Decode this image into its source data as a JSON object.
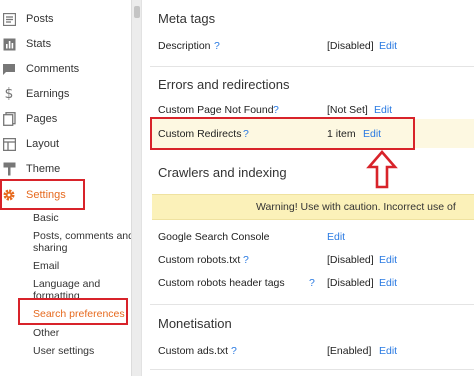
{
  "sidebar": {
    "items": [
      {
        "label": "Posts",
        "icon": "posts-icon"
      },
      {
        "label": "Stats",
        "icon": "stats-icon"
      },
      {
        "label": "Comments",
        "icon": "comments-icon"
      },
      {
        "label": "Earnings",
        "icon": "dollar-icon"
      },
      {
        "label": "Pages",
        "icon": "pages-icon"
      },
      {
        "label": "Layout",
        "icon": "layout-icon"
      },
      {
        "label": "Theme",
        "icon": "theme-icon"
      },
      {
        "label": "Settings",
        "icon": "gear-icon",
        "active": true
      }
    ],
    "settings_sub": {
      "basic": "Basic",
      "posts_comments": [
        "Posts, comments and",
        "sharing"
      ],
      "email": "Email",
      "language": [
        "Language and",
        "formatting"
      ],
      "search_preferences": "Search preferences",
      "other": "Other",
      "user_settings": "User settings"
    }
  },
  "main": {
    "meta_tags": {
      "title": "Meta tags",
      "description": {
        "label": "Description",
        "help": "?",
        "value": "[Disabled]",
        "action": "Edit"
      }
    },
    "errors": {
      "title": "Errors and redirections",
      "custom_page_not_found": {
        "label": "Custom Page Not Found",
        "help": "?",
        "value": "[Not Set]",
        "action": "Edit"
      },
      "custom_redirects": {
        "label": "Custom Redirects",
        "help": "?",
        "value": "1 item",
        "action": "Edit"
      }
    },
    "crawlers": {
      "title": "Crawlers and indexing",
      "warning": "Warning! Use with caution. Incorrect use of",
      "google_search_console": {
        "label": "Google Search Console",
        "action": "Edit"
      },
      "custom_robots_txt": {
        "label": "Custom robots.txt",
        "help": "?",
        "value": "[Disabled]",
        "action": "Edit"
      },
      "custom_robots_header": {
        "label": "Custom robots header tags",
        "help": "?",
        "value": "[Disabled]",
        "action": "Edit"
      }
    },
    "monetisation": {
      "title": "Monetisation",
      "custom_ads_txt": {
        "label": "Custom ads.txt",
        "help": "?",
        "value": "[Enabled]",
        "action": "Edit"
      }
    }
  },
  "colors": {
    "accent_orange": "#e66a1f",
    "link_blue": "#2a7ae2",
    "annotation_red": "#d8232a",
    "warning_bg": "#fbf1b9",
    "highlight_bg": "#fdf8e1"
  }
}
